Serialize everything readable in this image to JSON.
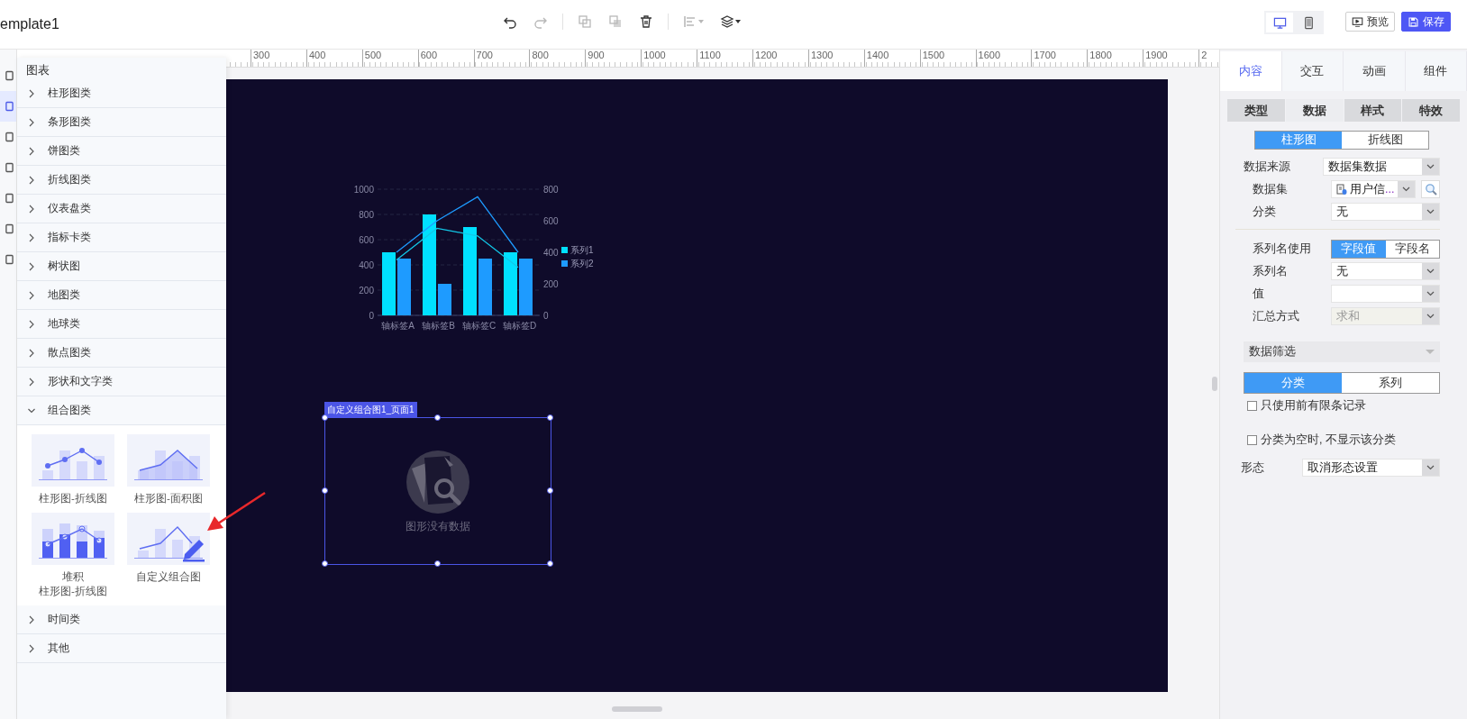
{
  "title": "emplate1",
  "toolbar": [
    [
      {
        "kind": "undo",
        "disabled": false,
        "caret": false
      },
      {
        "kind": "redo",
        "disabled": true,
        "caret": false
      }
    ],
    [
      {
        "kind": "copy",
        "disabled": true,
        "caret": false
      },
      {
        "kind": "paste",
        "disabled": true,
        "caret": false
      },
      {
        "kind": "delete",
        "disabled": false,
        "caret": false
      }
    ],
    [
      {
        "kind": "align",
        "disabled": true,
        "caret": true
      },
      {
        "kind": "layers",
        "disabled": false,
        "caret": true
      }
    ]
  ],
  "devices": [
    {
      "kind": "desktop",
      "selected": true
    },
    {
      "kind": "mobile",
      "selected": false
    }
  ],
  "actions": [
    {
      "kind": "preview",
      "label": "预览"
    },
    {
      "kind": "save",
      "label": "保存"
    }
  ],
  "ruler": [
    "300",
    "400",
    "500",
    "600",
    "700",
    "800",
    "900",
    "1000",
    "1100",
    "1200",
    "1300",
    "1400",
    "1500",
    "1600",
    "1700",
    "1800",
    "1900",
    "2"
  ],
  "nav": [
    {
      "selected": false
    },
    {
      "selected": true
    },
    {
      "selected": false
    },
    {
      "selected": false
    },
    {
      "selected": false
    },
    {
      "selected": false
    },
    {
      "selected": false
    }
  ],
  "panel": {
    "title": "图表",
    "categories": [
      {
        "label": "柱形图类",
        "expanded": false
      },
      {
        "label": "条形图类",
        "expanded": false
      },
      {
        "label": "饼图类",
        "expanded": false
      },
      {
        "label": "折线图类",
        "expanded": false
      },
      {
        "label": "仪表盘类",
        "expanded": false
      },
      {
        "label": "指标卡类",
        "expanded": false
      },
      {
        "label": "树状图",
        "expanded": false
      },
      {
        "label": "地图类",
        "expanded": false
      },
      {
        "label": "地球类",
        "expanded": false
      },
      {
        "label": "散点图类",
        "expanded": false
      },
      {
        "label": "形状和文字类",
        "expanded": false
      },
      {
        "label": "组合图类",
        "expanded": true,
        "items": [
          {
            "kind": "bar-line",
            "label": "柱形图-折线图"
          },
          {
            "kind": "bar-area",
            "label": "柱形图-面积图"
          },
          {
            "kind": "stacked-bar-line",
            "lines": [
              "堆积",
              "柱形图-折线图"
            ]
          },
          {
            "kind": "custom",
            "label": "自定义组合图"
          }
        ]
      },
      {
        "label": "时间类",
        "expanded": false
      },
      {
        "label": "其他",
        "expanded": false
      }
    ]
  },
  "canvas": {
    "chart": {
      "chart_data": {
        "type": "bar",
        "categories": [
          "轴标签A",
          "轴标签B",
          "轴标签C",
          "轴标签D"
        ],
        "ylim": [
          0,
          1000
        ],
        "yticks": [
          0,
          200,
          400,
          600,
          800,
          1000
        ],
        "y2lim": [
          0,
          800
        ],
        "y2ticks": [
          0,
          200,
          400,
          600,
          800
        ],
        "stacked": false,
        "grid": true,
        "legend": true,
        "series": [
          {
            "type": "bar",
            "name": "系列1",
            "color": "#00e0ff",
            "values": [
              500,
              800,
              700,
              500
            ]
          },
          {
            "type": "bar",
            "name": "系列2",
            "color": "#1e9bff",
            "values": [
              450,
              250,
              450,
              450
            ]
          },
          {
            "type": "line",
            "color": "#1e9bff",
            "values": [
              500,
              750,
              940,
              500
            ]
          },
          {
            "type": "line",
            "color": "#12c8e8",
            "values": [
              440,
              690,
              630,
              380
            ]
          }
        ]
      }
    },
    "widget": {
      "label": "自定义组合图1_页面1",
      "empty_text": "图形没有数据",
      "selected": true
    }
  },
  "inspector": {
    "tabs": [
      {
        "label": "内容",
        "selected": true
      },
      {
        "label": "交互",
        "selected": false
      },
      {
        "label": "动画",
        "selected": false
      },
      {
        "label": "组件",
        "selected": false
      }
    ],
    "subtabs": [
      {
        "label": "类型",
        "selected": false
      },
      {
        "label": "数据",
        "selected": true
      },
      {
        "label": "样式",
        "selected": false
      },
      {
        "label": "特效",
        "selected": false
      }
    ],
    "chart_types": [
      {
        "label": "柱形图",
        "selected": true
      },
      {
        "label": "折线图",
        "selected": false
      }
    ],
    "rows": [
      {
        "kind": "select",
        "label": "数据来源",
        "value": "数据集数据",
        "nested": false,
        "disabled": false
      },
      {
        "kind": "dataset",
        "label": "数据集",
        "value": "用户信...",
        "nested": true,
        "disabled": false
      },
      {
        "kind": "select",
        "label": "分类",
        "value": "无",
        "nested": true,
        "disabled": false
      },
      {
        "kind": "divider"
      },
      {
        "kind": "segmented",
        "label": "系列名使用",
        "nested": true,
        "options": [
          {
            "label": "字段值",
            "selected": true
          },
          {
            "label": "字段名",
            "selected": false
          }
        ]
      },
      {
        "kind": "select",
        "label": "系列名",
        "value": "无",
        "nested": true,
        "disabled": false
      },
      {
        "kind": "select",
        "label": "值",
        "nested": true,
        "disabled": false
      },
      {
        "kind": "select",
        "label": "汇总方式",
        "value": "求和",
        "nested": true,
        "disabled": true
      }
    ],
    "filter": {
      "title": "数据筛选",
      "options": [
        {
          "label": "分类",
          "selected": true
        },
        {
          "label": "系列",
          "selected": false
        }
      ],
      "checks": [
        {
          "label": "只使用前有限条记录",
          "checked": false
        },
        {
          "label": "分类为空时, 不显示该分类",
          "checked": false
        }
      ]
    },
    "shape": {
      "label": "形态",
      "value": "取消形态设置"
    }
  }
}
